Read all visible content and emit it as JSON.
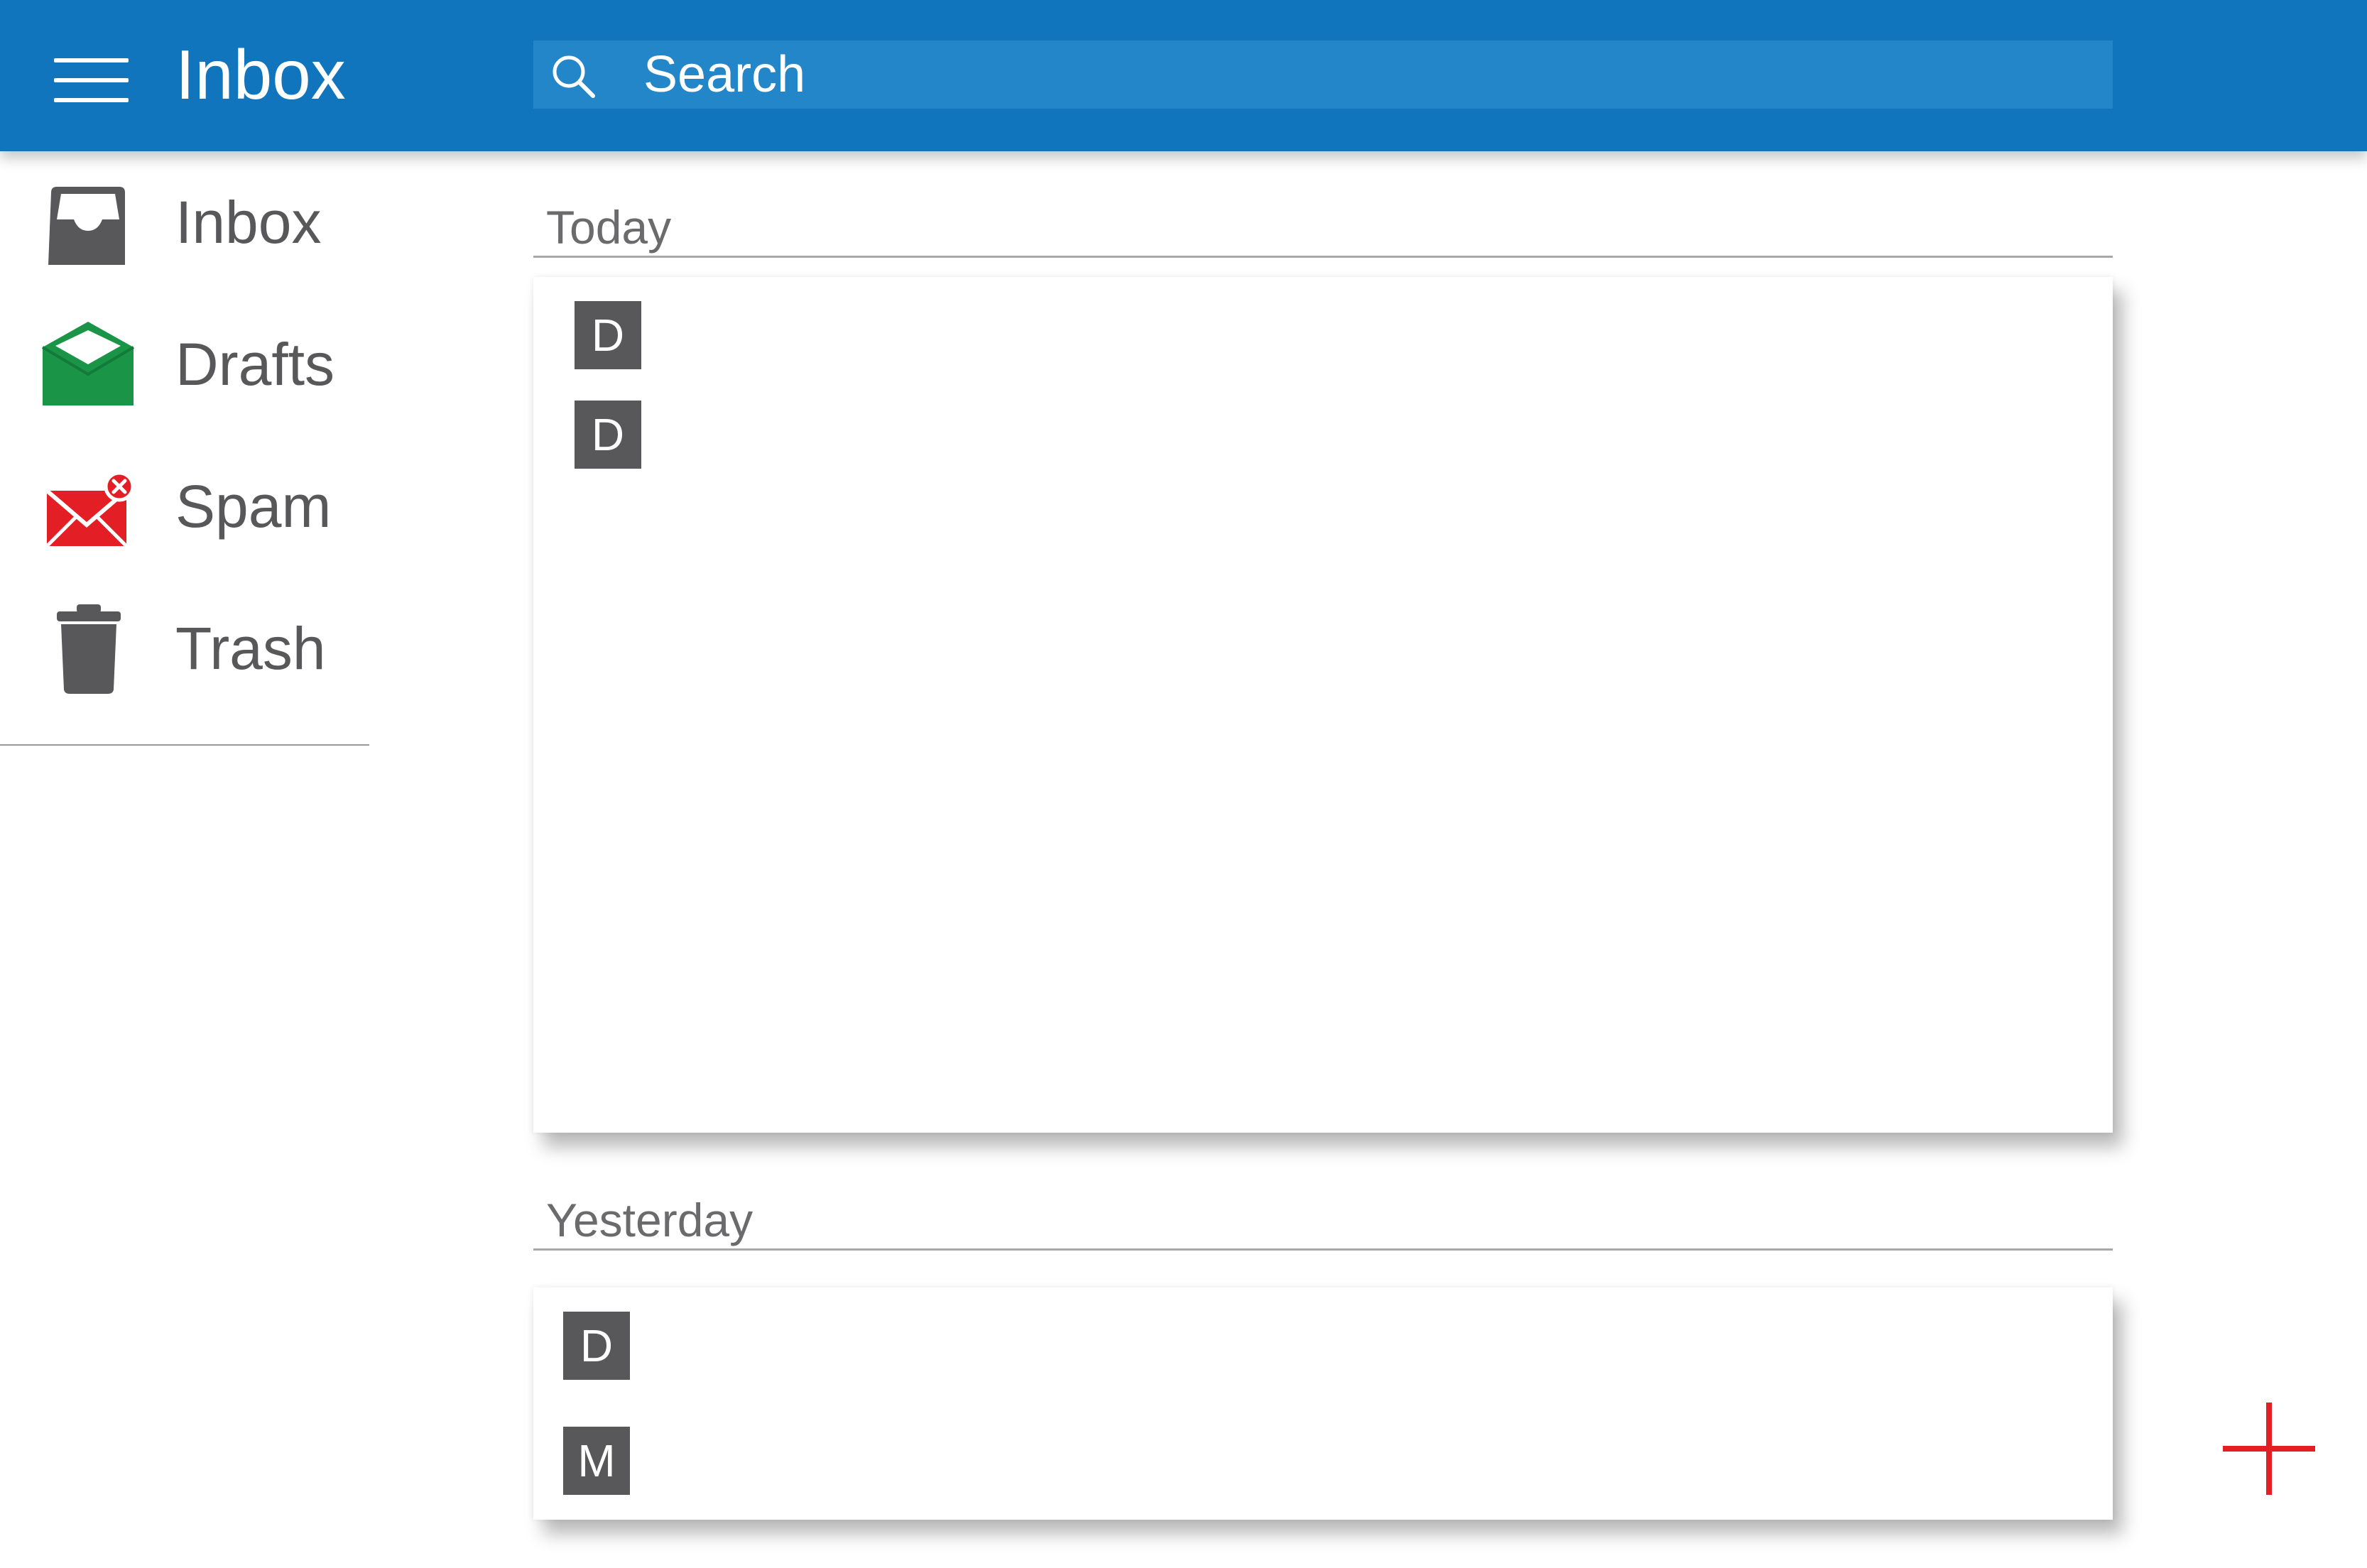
{
  "header": {
    "title": "Inbox",
    "menu_icon": "hamburger-menu-icon",
    "search": {
      "placeholder": "Search",
      "icon": "search-icon"
    }
  },
  "sidebar": {
    "items": [
      {
        "label": "Inbox",
        "icon": "inbox-tray-icon",
        "color": "#58585a"
      },
      {
        "label": "Drafts",
        "icon": "open-envelope-icon",
        "color": "#1a9447"
      },
      {
        "label": "Spam",
        "icon": "envelope-error-icon",
        "color": "#e31e25"
      },
      {
        "label": "Trash",
        "icon": "trash-can-icon",
        "color": "#58585a"
      }
    ]
  },
  "sections": [
    {
      "header": "Today",
      "messages": [
        {
          "avatar_letter": "D"
        },
        {
          "avatar_letter": "D"
        }
      ]
    },
    {
      "header": "Yesterday",
      "messages": [
        {
          "avatar_letter": "D"
        },
        {
          "avatar_letter": "M"
        }
      ]
    }
  ],
  "fab": {
    "icon": "plus-icon",
    "color": "#e31e25"
  },
  "colors": {
    "header_bg": "#1075bc",
    "search_bg": "#2386c9",
    "avatar_bg": "#58585a",
    "text_gray": "#58585a"
  }
}
